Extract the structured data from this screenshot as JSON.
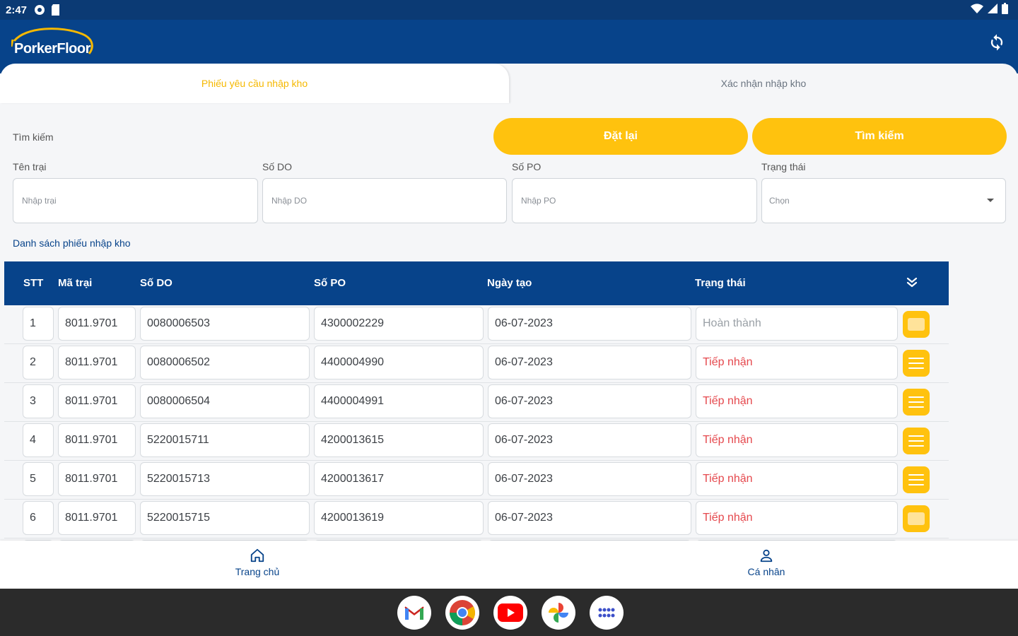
{
  "status_bar": {
    "time": "2:47"
  },
  "app": {
    "logo_text": "PorkerFloor"
  },
  "tabs": [
    {
      "label": "Phiếu yêu cầu nhập kho"
    },
    {
      "label": "Xác nhận nhập kho"
    }
  ],
  "search": {
    "label": "Tìm kiếm",
    "reset_label": "Đặt lại",
    "search_label": "Tìm kiếm",
    "fields": {
      "farm": {
        "label": "Tên trại",
        "placeholder": "Nhập trại"
      },
      "do": {
        "label": "Số DO",
        "placeholder": "Nhập DO"
      },
      "po": {
        "label": "Số PO",
        "placeholder": "Nhập PO"
      },
      "status": {
        "label": "Trạng thái",
        "placeholder": "Chọn"
      }
    }
  },
  "list": {
    "title": "Danh sách phiếu nhập kho",
    "headers": {
      "stt": "STT",
      "ma_trai": "Mã trại",
      "so_do": "Số DO",
      "so_po": "Số PO",
      "ngay_tao": "Ngày tạo",
      "trang_thai": "Trạng thái"
    },
    "rows": [
      {
        "stt": "1",
        "ma_trai": "8011.9701",
        "so_do": "0080006503",
        "so_po": "4300002229",
        "ngay_tao": "06-07-2023",
        "trang_thai": "Hoàn thành",
        "done": true
      },
      {
        "stt": "2",
        "ma_trai": "8011.9701",
        "so_do": "0080006502",
        "so_po": "4400004990",
        "ngay_tao": "06-07-2023",
        "trang_thai": "Tiếp nhận",
        "done": false
      },
      {
        "stt": "3",
        "ma_trai": "8011.9701",
        "so_do": "0080006504",
        "so_po": "4400004991",
        "ngay_tao": "06-07-2023",
        "trang_thai": "Tiếp nhận",
        "done": false
      },
      {
        "stt": "4",
        "ma_trai": "8011.9701",
        "so_do": "5220015711",
        "so_po": "4200013615",
        "ngay_tao": "06-07-2023",
        "trang_thai": "Tiếp nhận",
        "done": false
      },
      {
        "stt": "5",
        "ma_trai": "8011.9701",
        "so_do": "5220015713",
        "so_po": "4200013617",
        "ngay_tao": "06-07-2023",
        "trang_thai": "Tiếp nhận",
        "done": false
      },
      {
        "stt": "6",
        "ma_trai": "8011.9701",
        "so_do": "5220015715",
        "so_po": "4200013619",
        "ngay_tao": "06-07-2023",
        "trang_thai": "Tiếp nhận",
        "done": false
      }
    ]
  },
  "bottom_nav": [
    {
      "label": "Trang chủ",
      "icon": "home-icon"
    },
    {
      "label": "Cá nhân",
      "icon": "person-icon"
    }
  ],
  "dock": [
    "gmail-icon",
    "chrome-icon",
    "youtube-icon",
    "photos-icon",
    "apps-icon"
  ],
  "colors": {
    "primary": "#07438a",
    "accent": "#ffc20e",
    "status_received": "#e5484d",
    "status_done": "#9aa0a6"
  }
}
